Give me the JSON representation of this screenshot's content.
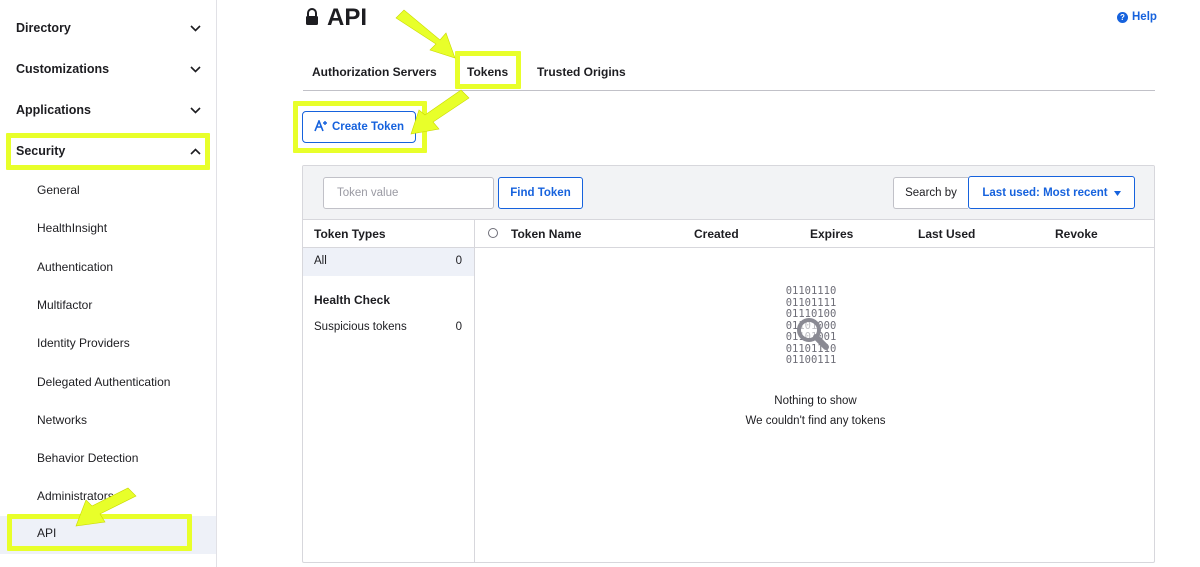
{
  "sidebar": {
    "groups": [
      {
        "label": "Directory"
      },
      {
        "label": "Customizations"
      },
      {
        "label": "Applications"
      },
      {
        "label": "Security"
      }
    ],
    "security_items": [
      {
        "label": "General"
      },
      {
        "label": "HealthInsight"
      },
      {
        "label": "Authentication"
      },
      {
        "label": "Multifactor"
      },
      {
        "label": "Identity Providers"
      },
      {
        "label": "Delegated Authentication"
      },
      {
        "label": "Networks"
      },
      {
        "label": "Behavior Detection"
      },
      {
        "label": "Administrators"
      },
      {
        "label": "API"
      }
    ],
    "active_item": "API"
  },
  "header": {
    "title": "API",
    "help_label": "Help"
  },
  "tabs": [
    {
      "label": "Authorization Servers"
    },
    {
      "label": "Tokens"
    },
    {
      "label": "Trusted Origins"
    }
  ],
  "active_tab": "Tokens",
  "actions": {
    "create_token_label": "Create Token"
  },
  "filter_bar": {
    "token_input_placeholder": "Token value",
    "find_label": "Find Token",
    "search_by_label": "Search by",
    "sort_selected": "Last used: Most recent"
  },
  "token_types": {
    "header": "Token Types",
    "all_label": "All",
    "all_count": "0",
    "health_header": "Health Check",
    "suspicious_label": "Suspicious tokens",
    "suspicious_count": "0"
  },
  "table": {
    "columns": [
      "Token Name",
      "Created",
      "Expires",
      "Last Used",
      "Revoke"
    ]
  },
  "empty_state": {
    "binary_lines": [
      "01101110",
      "01101111",
      "01110100",
      "01101000",
      "01101001",
      "01101110",
      "01100111"
    ],
    "title": "Nothing to show",
    "message": "We couldn't find any tokens"
  },
  "colors": {
    "accent": "#1662dd",
    "highlight": "#e8ff2a",
    "active_bg": "#eef1f8"
  }
}
